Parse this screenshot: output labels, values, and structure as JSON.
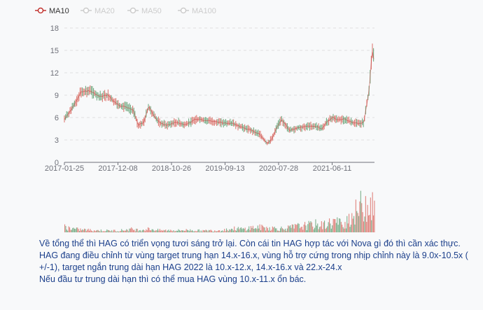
{
  "chart_data": {
    "type": "line",
    "title": "",
    "legend": {
      "placement": "top-left",
      "items": [
        {
          "name": "MA10",
          "active": true,
          "color": "#c23531"
        },
        {
          "name": "MA20",
          "active": false,
          "color": "#cccccc"
        },
        {
          "name": "MA50",
          "active": false,
          "color": "#cccccc"
        },
        {
          "name": "MA100",
          "active": false,
          "color": "#cccccc"
        }
      ]
    },
    "x_tick_labels": [
      "2017-01-25",
      "2017-12-08",
      "2018-10-26",
      "2019-09-13",
      "2020-07-28",
      "2021-06-11"
    ],
    "y_ticks": [
      0,
      3,
      6,
      9,
      12,
      15,
      18
    ],
    "ylim": [
      0,
      18
    ],
    "grid": true,
    "series": [
      {
        "name": "MA10",
        "x": [
          "2017-01-25",
          "2017-03-10",
          "2017-05-01",
          "2017-06-20",
          "2017-08-10",
          "2017-10-01",
          "2017-11-10",
          "2017-12-08",
          "2018-01-10",
          "2018-02-20",
          "2018-03-20",
          "2018-04-20",
          "2018-05-20",
          "2018-06-20",
          "2018-07-25",
          "2018-09-01",
          "2018-10-26",
          "2018-12-15",
          "2019-02-15",
          "2019-04-15",
          "2019-06-15",
          "2019-08-15",
          "2019-09-13",
          "2019-10-20",
          "2019-12-15",
          "2020-02-10",
          "2020-03-25",
          "2020-04-20",
          "2020-05-20",
          "2020-06-15",
          "2020-07-10",
          "2020-07-28",
          "2020-09-10",
          "2020-11-01",
          "2020-12-20",
          "2021-02-01",
          "2021-03-01",
          "2021-04-01",
          "2021-05-01",
          "2021-06-11",
          "2021-07-20",
          "2021-09-01",
          "2021-09-25",
          "2021-10-10",
          "2021-10-25",
          "2021-11-05",
          "2021-11-15",
          "2021-11-25"
        ],
        "values": [
          5.8,
          7.2,
          9.5,
          9.6,
          8.8,
          9.0,
          8.0,
          7.6,
          7.4,
          7.0,
          5.0,
          5.3,
          7.5,
          6.2,
          5.2,
          5.0,
          5.4,
          5.0,
          5.8,
          5.6,
          5.4,
          5.2,
          5.2,
          4.8,
          4.4,
          3.8,
          2.5,
          3.2,
          4.8,
          5.7,
          5.0,
          4.2,
          4.6,
          4.8,
          4.9,
          4.5,
          5.5,
          6.0,
          5.7,
          5.8,
          5.3,
          5.2,
          5.3,
          7.5,
          9.5,
          13.0,
          15.2,
          13.0
        ]
      }
    ],
    "volume": {
      "name": "Volume",
      "values": [
        0.18,
        0.12,
        0.09,
        0.08,
        0.07,
        0.06,
        0.06,
        0.05,
        0.06,
        0.07,
        0.1,
        0.08,
        0.09,
        0.11,
        0.07,
        0.06,
        0.07,
        0.06,
        0.07,
        0.07,
        0.06,
        0.05,
        0.06,
        0.06,
        0.08,
        0.1,
        0.12,
        0.1,
        0.14,
        0.16,
        0.15,
        0.14,
        0.13,
        0.12,
        0.14,
        0.18,
        0.2,
        0.22,
        0.25,
        0.22,
        0.28,
        0.35,
        0.25,
        0.45,
        0.6,
        0.85,
        0.95,
        0.7
      ]
    }
  },
  "caption": {
    "line1": "Về tổng thể thì HAG có triển vọng tươi sáng trở lại. Còn cái tin HAG hợp tác với Nova gì đó thì cần xác thực.",
    "line2": "HAG đang điều chỉnh từ vùng target trung hạn 14.x-16.x, vùng hỗ trợ cứng trong nhịp chỉnh này là 9.0x-10.5x ( +/-1), target ngắn trung dài hạn HAG 2022 là 10.x-12.x, 14.x-16.x và 22.x-24.x",
    "line3": "Nếu đầu tư trung dài hạn thì có thể mua HAG vùng 10.x-11.x ổn bác."
  }
}
